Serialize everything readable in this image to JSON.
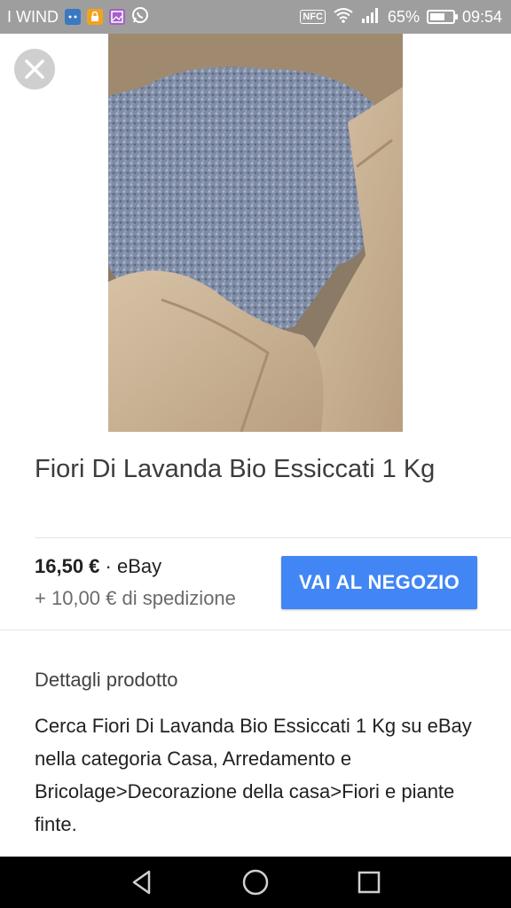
{
  "status_bar": {
    "carrier": "I WIND",
    "nfc_label": "NFC",
    "battery_percent": "65%",
    "battery_level": 0.65,
    "time": "09:54",
    "notification_icons": [
      "messenger-icon",
      "lock-app-icon",
      "gallery-icon",
      "whatsapp-icon"
    ]
  },
  "product": {
    "title": "Fiori Di Lavanda Bio Essiccati 1 Kg",
    "price": "16,50 €",
    "separator": " · ",
    "seller": "eBay",
    "shipping": "+ 10,00 € di spedizione",
    "shop_button": "VAI AL NEGOZIO"
  },
  "details": {
    "heading": "Dettagli prodotto",
    "description": "Cerca Fiori Di Lavanda Bio Essiccati 1 Kg su eBay nella categoria Casa, Arredamento e Bricolage>Decorazione della casa>Fiori e piante finte."
  },
  "colors": {
    "status_bar": "#9e9e9e",
    "accent_button": "#4285f4",
    "nav_bar": "#000000"
  },
  "nav": {
    "icons": [
      "back-icon",
      "home-icon",
      "recents-icon"
    ]
  }
}
